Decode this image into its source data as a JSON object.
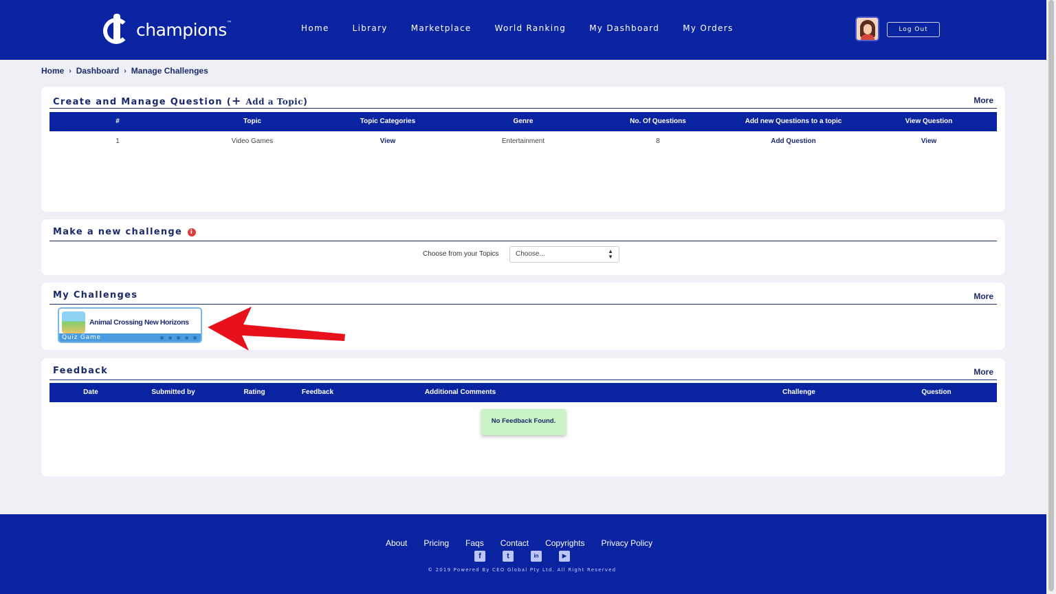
{
  "header": {
    "logo_text": "champions",
    "logo_tm": "™",
    "nav": [
      "Home",
      "Library",
      "Marketplace",
      "World Ranking",
      "My Dashboard",
      "My Orders"
    ],
    "logout_label": "Log Out"
  },
  "breadcrumb": [
    "Home",
    "Dashboard",
    "Manage Challenges"
  ],
  "questions_card": {
    "title": "Create and Manage Question",
    "add_topic_open": "(",
    "add_topic_plus": "+",
    "add_topic_label": "Add a Topic",
    "add_topic_close": ")",
    "more": "More",
    "columns": [
      "#",
      "Topic",
      "Topic Categories",
      "Genre",
      "No. Of Questions",
      "Add new Questions to a topic",
      "View Question"
    ],
    "rows": [
      {
        "num": "1",
        "topic": "Video Games",
        "categories": "View",
        "genre": "Entertainment",
        "count": "8",
        "add": "Add Question",
        "view": "View"
      }
    ]
  },
  "new_challenge_card": {
    "title": "Make a new challenge",
    "info": "i",
    "choose_label": "Choose from your Topics",
    "select_value": "Choose...",
    "select_arrows": "▲▼"
  },
  "challenges_card": {
    "title": "My Challenges",
    "more": "More",
    "items": [
      {
        "name": "Animal Crossing New Horizons",
        "type": "Quiz Game"
      }
    ]
  },
  "feedback_card": {
    "title": "Feedback",
    "more": "More",
    "columns": [
      "Date",
      "Submitted by",
      "Rating",
      "Feedback",
      "Additional Comments",
      "Challenge",
      "Question"
    ],
    "empty_message": "No Feedback Found."
  },
  "footer": {
    "links": [
      "About",
      "Pricing",
      "Faqs",
      "Contact",
      "Copyrights",
      "Privacy Policy"
    ],
    "socials": [
      {
        "icon": "facebook-icon",
        "glyph": "f"
      },
      {
        "icon": "twitter-icon",
        "glyph": "t"
      },
      {
        "icon": "linkedin-icon",
        "glyph": "in"
      },
      {
        "icon": "youtube-icon",
        "glyph": "▶"
      }
    ],
    "copyright": "© 2019 Powered By CEO Global Pty Ltd. All Right Reserved"
  },
  "colors": {
    "brand_blue": "#0a23a0",
    "annotation_arrow": "#e8101a",
    "empty_state_bg": "#c9f3c4"
  }
}
